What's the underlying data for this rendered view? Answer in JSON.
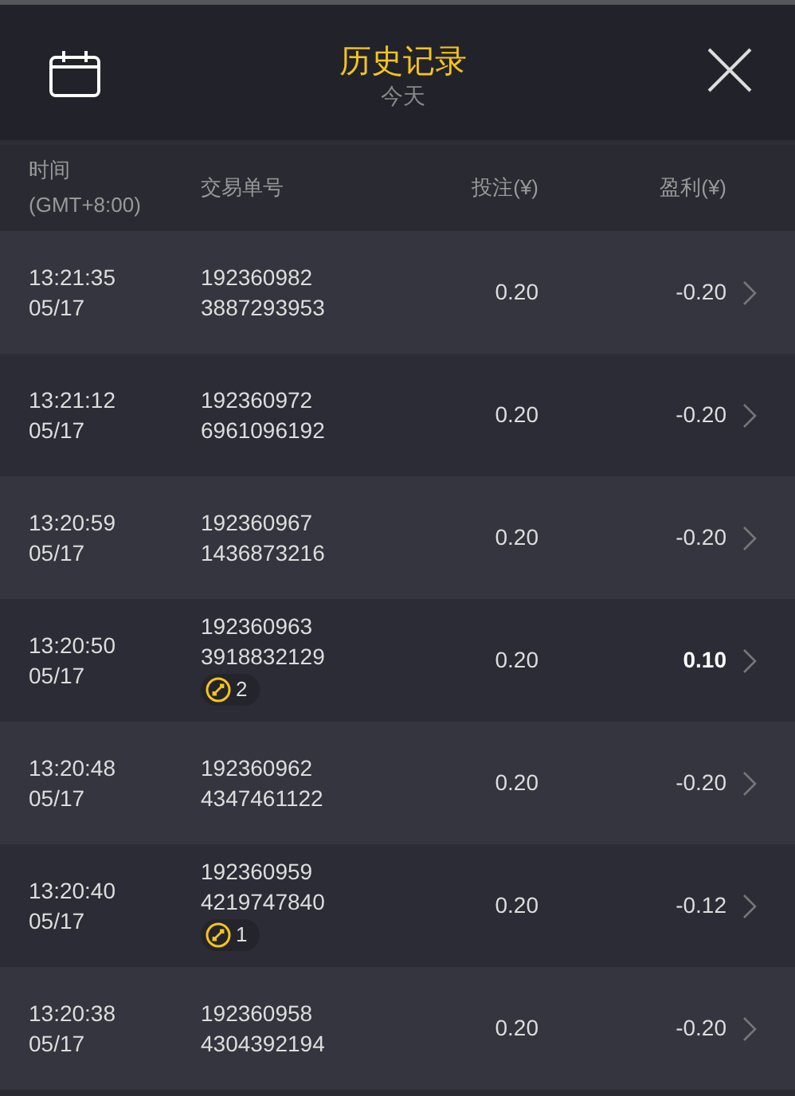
{
  "header": {
    "title": "历史记录",
    "subtitle": "今天"
  },
  "columns": [
    {
      "lines": [
        "时间",
        "(GMT+8:00)"
      ]
    },
    {
      "lines": [
        "交易单号"
      ]
    },
    {
      "lines": [
        "投注(¥)"
      ]
    },
    {
      "lines": [
        "盈利(¥)"
      ]
    }
  ],
  "rows": [
    {
      "time": "13:21:35",
      "date": "05/17",
      "id_1": "192360982",
      "id_2": "3887293953",
      "bet": "0.20",
      "profit": "-0.20",
      "highlight": false
    },
    {
      "time": "13:21:12",
      "date": "05/17",
      "id_1": "192360972",
      "id_2": "6961096192",
      "bet": "0.20",
      "profit": "-0.20",
      "highlight": false
    },
    {
      "time": "13:20:59",
      "date": "05/17",
      "id_1": "192360967",
      "id_2": "1436873216",
      "bet": "0.20",
      "profit": "-0.20",
      "highlight": false
    },
    {
      "time": "13:20:50",
      "date": "05/17",
      "id_1": "192360963",
      "id_2": "3918832129",
      "badge": "2",
      "bet": "0.20",
      "profit": "0.10",
      "highlight": true
    },
    {
      "time": "13:20:48",
      "date": "05/17",
      "id_1": "192360962",
      "id_2": "4347461122",
      "bet": "0.20",
      "profit": "-0.20",
      "highlight": false
    },
    {
      "time": "13:20:40",
      "date": "05/17",
      "id_1": "192360959",
      "id_2": "4219747840",
      "badge": "1",
      "bet": "0.20",
      "profit": "-0.12",
      "highlight": false
    },
    {
      "time": "13:20:38",
      "date": "05/17",
      "id_1": "192360958",
      "id_2": "4304392194",
      "bet": "0.20",
      "profit": "-0.20",
      "highlight": false
    }
  ]
}
